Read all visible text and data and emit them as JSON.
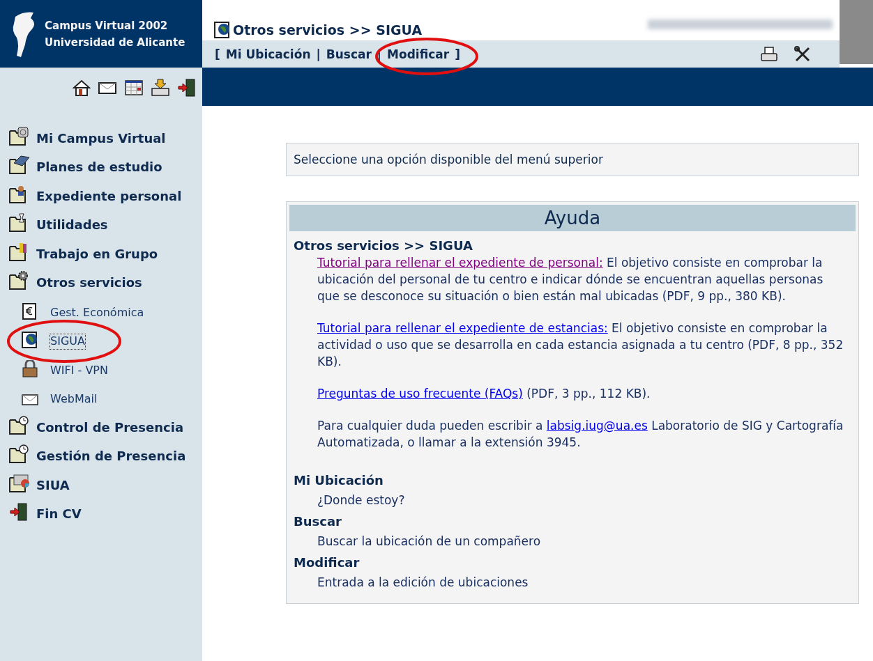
{
  "logo": {
    "line_1": "Campus Virtual 2002",
    "line_2": "Universidad de Alicante"
  },
  "header": {
    "title": "Otros servicios >> SIGUA",
    "nav_open": "[",
    "nav_links": [
      "Mi Ubicación",
      "Buscar",
      "Modificar"
    ],
    "nav_separators": [
      "|",
      "|"
    ],
    "nav_close": "]"
  },
  "sidebar": {
    "items": [
      {
        "kind": "section",
        "label": "Mi Campus Virtual",
        "selected": false
      },
      {
        "kind": "section",
        "label": "Planes de estudio",
        "selected": false
      },
      {
        "kind": "section",
        "label": "Expediente personal",
        "selected": false
      },
      {
        "kind": "section",
        "label": "Utilidades",
        "selected": false
      },
      {
        "kind": "section",
        "label": "Trabajo en Grupo",
        "selected": false
      },
      {
        "kind": "section",
        "label": "Otros servicios",
        "selected": false
      },
      {
        "kind": "sub",
        "label": "Gest. Económica",
        "selected": false
      },
      {
        "kind": "sub",
        "label": "SIGUA",
        "selected": true
      },
      {
        "kind": "sub",
        "label": "WIFI - VPN",
        "selected": false
      },
      {
        "kind": "sub",
        "label": "WebMail",
        "selected": false
      },
      {
        "kind": "section",
        "label": "Control de Presencia",
        "selected": false
      },
      {
        "kind": "section",
        "label": "Gestión de Presencia",
        "selected": false
      },
      {
        "kind": "section",
        "label": "SIUA",
        "selected": false
      },
      {
        "kind": "section",
        "label": "Fin CV",
        "selected": false
      }
    ]
  },
  "notice": "Seleccione una opción disponible del menú superior",
  "help": {
    "title": "Ayuda",
    "heading": "Otros servicios >> SIGUA",
    "paragraphs": [
      {
        "link": "Tutorial para rellenar el expediente de personal:",
        "visited": true,
        "after": " El objetivo consiste en comprobar la ubicación del personal de tu centro e indicar dónde se encuentran aquellas personas que se desconoce su situación o bien están mal ubicadas (PDF, 9 pp., 380 KB)."
      },
      {
        "link": "Tutorial para rellenar el expediente de estancias:",
        "visited": false,
        "after": " El objetivo consiste en comprobar la actividad o uso que se desarrolla en cada estancia asignada a tu centro (PDF, 8 pp., 352 KB)."
      },
      {
        "link": "Preguntas de uso frecuente (FAQs)",
        "visited": false,
        "after": " (PDF, 3 pp., 112 KB)."
      },
      {
        "before": "Para cualquier duda pueden escribir a ",
        "link": "labsig.iug@ua.es",
        "visited": false,
        "after": " Laboratorio de SIG y Cartografía Automatizada, o llamar a la extensión 3945."
      }
    ],
    "sections": [
      {
        "title": "Mi Ubicación",
        "text": "¿Donde estoy?"
      },
      {
        "title": "Buscar",
        "text": "Buscar la ubicación de un compañero"
      },
      {
        "title": "Modificar",
        "text": "Entrada a la edición de ubicaciones"
      }
    ]
  }
}
